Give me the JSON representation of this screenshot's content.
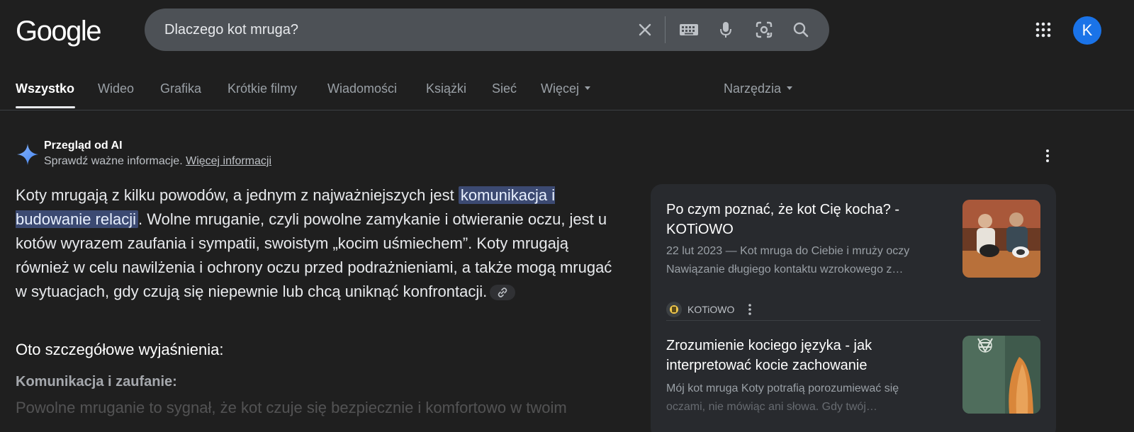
{
  "logo": {
    "text": "Google"
  },
  "search": {
    "query": "Dlaczego kot mruga?"
  },
  "user": {
    "avatar_letter": "K",
    "avatar_color": "#1a73e8"
  },
  "tabs": [
    {
      "label": "Wszystko",
      "active": true
    },
    {
      "label": "Wideo"
    },
    {
      "label": "Grafika"
    },
    {
      "label": "Krótkie filmy"
    },
    {
      "label": "Wiadomości"
    },
    {
      "label": "Książki"
    },
    {
      "label": "Sieć"
    },
    {
      "label": "Więcej"
    }
  ],
  "tools": {
    "label": "Narzędzia"
  },
  "ai_overview": {
    "title": "Przegląd od AI",
    "subtitle": "Sprawdź ważne informacje.",
    "more_info_link": "Więcej informacji",
    "intro_pre": "Koty mrugają z kilku powodów, a jednym z najważniejszych jest ",
    "highlight": "komunikacja i budowanie relacji",
    "intro_post": ". Wolne mruganie, czyli powolne zamykanie i otwieranie oczu, jest u kotów wyrazem zaufania i sympatii, swoistym „kocim uśmiechem”. Koty mrugają również w celu nawilżenia i ochrony oczu przed podrażnieniami, a także mogą mrugać w sytuacjach, gdy czują się niepewnie lub chcą uniknąć konfrontacji.",
    "details_heading": "Oto szczegółowe wyjaśnienia:",
    "subheading": "Komunikacja i zaufanie:",
    "faded_text": "Powolne mruganie to sygnał, że kot czuje się bezpiecznie i komfortowo w twoim"
  },
  "sources": [
    {
      "title": "Po czym poznać, że kot Cię kocha? - KOTiOWO",
      "snippet_line1": "22 lut 2023 — Kot mruga do Ciebie i mruży oczy",
      "snippet_line2": "Nawiązanie długiego kontaktu wzrokowego z…",
      "source_name": "KOTiOWO"
    },
    {
      "title": "Zrozumienie kociego języka - jak interpretować kocie zachowanie",
      "snippet_line1": "Mój kot mruga Koty potrafią porozumiewać się",
      "snippet_line2": "oczami, nie mówiąc ani słowa. Gdy twój…"
    }
  ]
}
